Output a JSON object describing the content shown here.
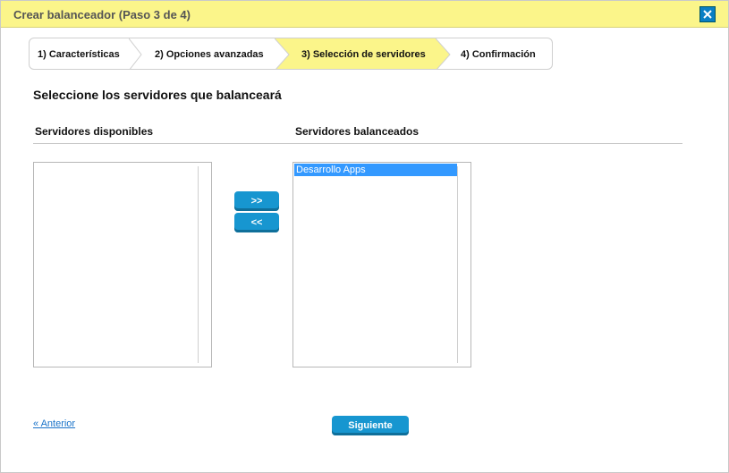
{
  "dialog": {
    "title": "Crear balanceador (Paso 3 de 4)",
    "close_icon": "close-icon"
  },
  "wizard": {
    "steps": [
      {
        "label": "1) Características",
        "active": false
      },
      {
        "label": "2) Opciones avanzadas",
        "active": false
      },
      {
        "label": "3) Selección de servidores",
        "active": true
      },
      {
        "label": "4) Confirmación",
        "active": false
      }
    ]
  },
  "main": {
    "heading": "Seleccione los servidores que balanceará",
    "available_header": "Servidores disponibles",
    "balanced_header": "Servidores balanceados",
    "available_items": [],
    "balanced_items": [
      {
        "label": "Desarrollo Apps",
        "selected": true
      }
    ]
  },
  "actions": {
    "add_label": ">>",
    "remove_label": "<<",
    "back_link": "« Anterior",
    "next_label": "Siguiente"
  },
  "colors": {
    "titlebar": "#fbf58a",
    "accent": "#1796d0",
    "selection": "#3399ff"
  }
}
